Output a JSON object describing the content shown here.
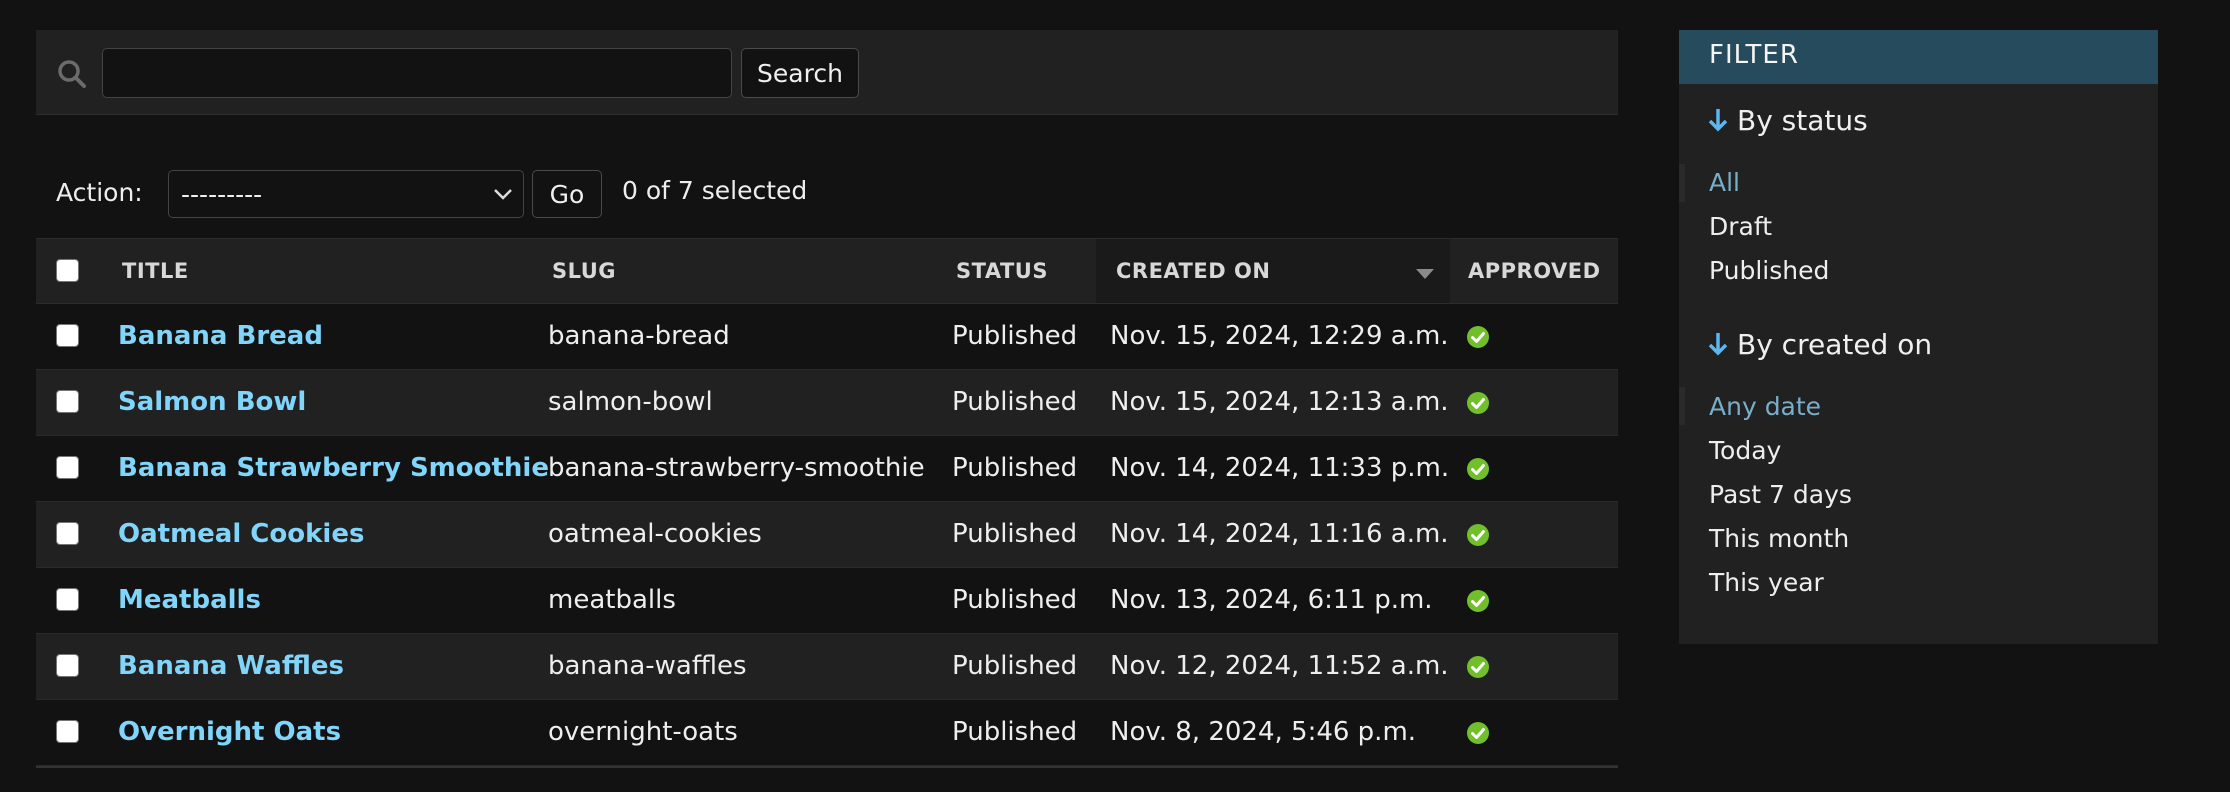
{
  "search": {
    "value": "",
    "placeholder": "",
    "button_label": "Search"
  },
  "actions": {
    "label": "Action:",
    "selected_option": "---------",
    "go_label": "Go",
    "selection_count": "0 of 7 selected"
  },
  "table": {
    "columns": [
      "TITLE",
      "SLUG",
      "STATUS",
      "CREATED ON",
      "APPROVED"
    ],
    "sorted_column": "CREATED ON",
    "rows": [
      {
        "title": "Banana Bread",
        "slug": "banana-bread",
        "status": "Published",
        "created_on": "Nov. 15, 2024, 12:29 a.m.",
        "approved": true
      },
      {
        "title": "Salmon Bowl",
        "slug": "salmon-bowl",
        "status": "Published",
        "created_on": "Nov. 15, 2024, 12:13 a.m.",
        "approved": true
      },
      {
        "title": "Banana Strawberry Smoothie",
        "slug": "banana-strawberry-smoothie",
        "status": "Published",
        "created_on": "Nov. 14, 2024, 11:33 p.m.",
        "approved": true
      },
      {
        "title": "Oatmeal Cookies",
        "slug": "oatmeal-cookies",
        "status": "Published",
        "created_on": "Nov. 14, 2024, 11:16 a.m.",
        "approved": true
      },
      {
        "title": "Meatballs",
        "slug": "meatballs",
        "status": "Published",
        "created_on": "Nov. 13, 2024, 6:11 p.m.",
        "approved": true
      },
      {
        "title": "Banana Waffles",
        "slug": "banana-waffles",
        "status": "Published",
        "created_on": "Nov. 12, 2024, 11:52 a.m.",
        "approved": true
      },
      {
        "title": "Overnight Oats",
        "slug": "overnight-oats",
        "status": "Published",
        "created_on": "Nov. 8, 2024, 5:46 p.m.",
        "approved": true
      }
    ]
  },
  "filter": {
    "header": "FILTER",
    "groups": [
      {
        "title": "By status",
        "options": [
          "All",
          "Draft",
          "Published"
        ],
        "selected": 0
      },
      {
        "title": "By created on",
        "options": [
          "Any date",
          "Today",
          "Past 7 days",
          "This month",
          "This year"
        ],
        "selected": 0
      }
    ]
  },
  "colors": {
    "link": "#81d4fa",
    "filter_header_bg": "#264b5d",
    "filter_selected": "#79aec8",
    "approved_icon": "#70bf2b",
    "arrow_icon": "#5eb6ec"
  }
}
